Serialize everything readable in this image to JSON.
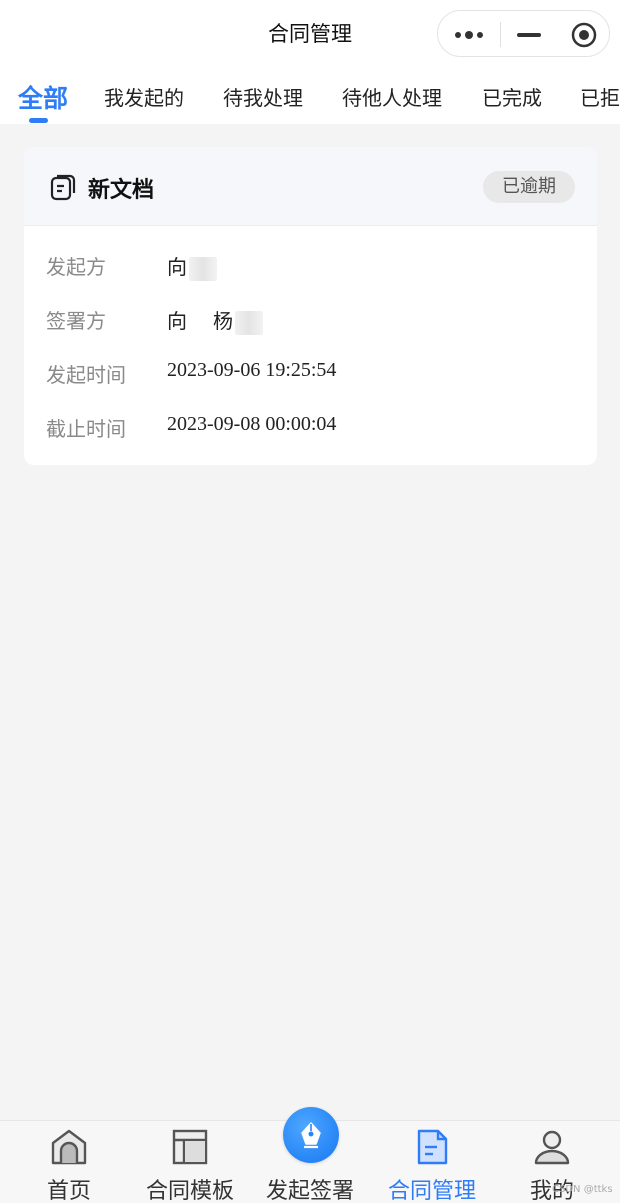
{
  "navbar": {
    "title": "合同管理",
    "capsule_icons": [
      "more-icon",
      "minimize-icon",
      "close-circle-icon"
    ]
  },
  "tabs": [
    {
      "label": "全部",
      "active": true
    },
    {
      "label": "我发起的",
      "active": false
    },
    {
      "label": "待我处理",
      "active": false
    },
    {
      "label": "待他人处理",
      "active": false
    },
    {
      "label": "已完成",
      "active": false
    },
    {
      "label": "已拒",
      "active": false
    }
  ],
  "card": {
    "icon": "document-icon",
    "title": "新文档",
    "badge": "已逾期",
    "fields": [
      {
        "label": "发起方",
        "value": "向"
      },
      {
        "label": "签署方",
        "value": "向",
        "value2": "杨"
      },
      {
        "label": "发起时间",
        "value": "2023-09-06 19:25:54"
      },
      {
        "label": "截止时间",
        "value": "2023-09-08 00:00:04"
      }
    ]
  },
  "tabbar": {
    "items": [
      {
        "label": "首页",
        "icon": "home-icon",
        "active": false
      },
      {
        "label": "合同模板",
        "icon": "template-icon",
        "active": false
      },
      {
        "label": "发起签署",
        "icon": "sign-pen-icon",
        "active": false
      },
      {
        "label": "合同管理",
        "icon": "contract-doc-icon",
        "active": true
      },
      {
        "label": "我的",
        "icon": "user-icon",
        "active": false
      }
    ]
  },
  "watermark": "CSDN @ttks",
  "colors": {
    "accent": "#2f7df6",
    "background": "#f4f4f4",
    "badge_bg": "#e8e8e8"
  }
}
